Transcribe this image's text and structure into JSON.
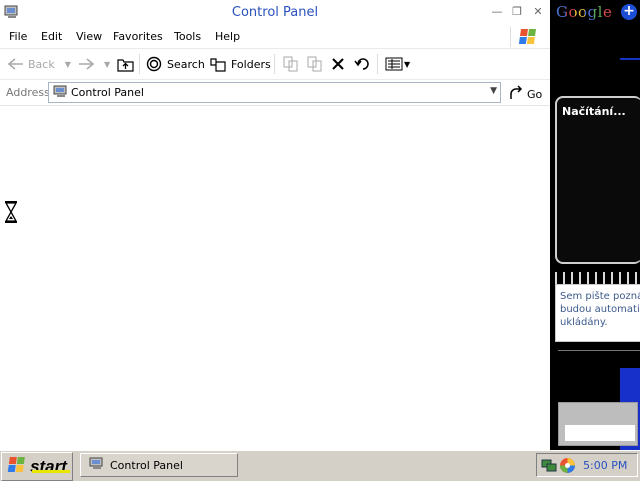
{
  "window": {
    "title": "Control Panel",
    "minimize": "—",
    "restore": "❐",
    "close": "✕"
  },
  "menu": [
    "File",
    "Edit",
    "View",
    "Favorites",
    "Tools",
    "Help"
  ],
  "toolbar": {
    "back_label": "Back",
    "search_label": "Search",
    "folders_label": "Folders"
  },
  "address": {
    "label": "Address",
    "value": "Control Panel",
    "go_label": "Go"
  },
  "sidebar": {
    "google_logo": "Google",
    "gadget_loading_text": "Načítání...",
    "notes_lines": [
      "Sem pište poznám",
      "budou automatic",
      "ukládány."
    ]
  },
  "taskbar": {
    "start_label": "start",
    "task_label": "Control Panel",
    "clock": "5:00 PM"
  },
  "colors": {
    "title_blue": "#2a52be",
    "sidebar_blue": "#1434c8",
    "taskbar_gray": "#d4d0c8"
  },
  "icons": [
    "control-panel-icon",
    "windows-flag-icon",
    "back-arrow-icon",
    "forward-arrow-icon",
    "folder-up-icon",
    "search-icon",
    "folders-icon",
    "move-to-icon",
    "copy-to-icon",
    "delete-icon",
    "undo-icon",
    "views-icon",
    "go-arrow-icon",
    "hourglass-icon",
    "network-tray-icon",
    "tray-app-icon"
  ]
}
